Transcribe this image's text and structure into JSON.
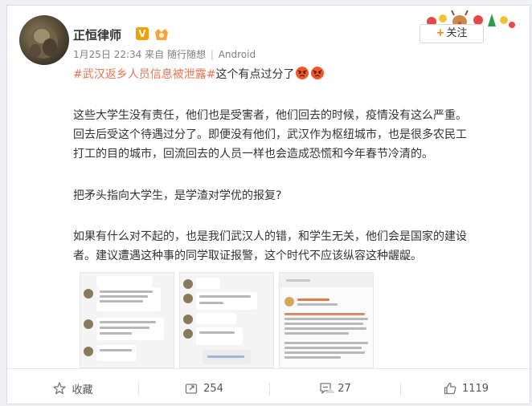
{
  "post": {
    "author": "正恒律师",
    "verified_badge": "V",
    "date": "1月25日 22:34",
    "from_label": "来自",
    "source": "随行随想",
    "separator": "|",
    "device": "Android",
    "follow_label": "关注",
    "hashtag": "#武汉返乡人员信息被泄露#",
    "headline_tail": "这个有点过分了",
    "para1_line1": "这些大学生没有责任，他们也是受害者，他们回去的时候，疫情没有这么严重。",
    "para1_line2": "回去后受这个待遇过分了。即便没有他们，武汉作为枢纽城市，也是很多农民工",
    "para1_line3": "打工的目的城市，回流回去的人员一样也会造成恐慌和今年春节冷清的。",
    "para2": "把矛头指向大学生，是学渣对学优的报复?",
    "para3_line1": "如果有什么对不起的，也是我们武汉人的错，和学生无关，他们会是国家的建设",
    "para3_line2": "者。建议遭遇这种事的同学取证报警，这个时代不应该纵容这种龌龊。"
  },
  "actions": {
    "favorite_label": "收藏",
    "repost_count": "254",
    "comment_count": "27",
    "like_count": "1119"
  },
  "colors": {
    "hashtag": "#eb7350",
    "follow_plus": "#ff8200",
    "verified": "#f0a000"
  },
  "icons": [
    "star-icon",
    "repost-icon",
    "comment-icon",
    "thumbs-up-icon",
    "angry-emoji-icon"
  ]
}
